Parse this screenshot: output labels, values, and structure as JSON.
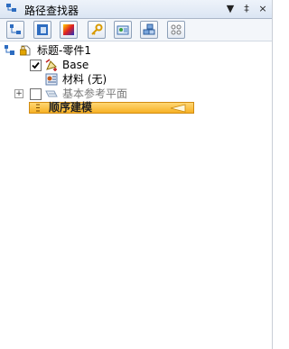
{
  "window": {
    "title": "路径查找器",
    "controls": {
      "dropdown": "▼",
      "pin": "‡",
      "close": "×"
    }
  },
  "toolbar": {
    "buttons": [
      {
        "icon": "tree-hierarchy-icon"
      },
      {
        "icon": "layout-view-icon"
      },
      {
        "icon": "color-view-icon"
      },
      {
        "icon": "key-icon"
      },
      {
        "icon": "image-view-icon"
      },
      {
        "icon": "assembly-icon"
      },
      {
        "icon": "grid-view-icon"
      }
    ]
  },
  "tree": {
    "root": {
      "label": "标题-零件1"
    },
    "items": [
      {
        "label": "Base",
        "checked": true
      },
      {
        "label": "材料 (无)"
      },
      {
        "label": "基本参考平面",
        "checked": false,
        "expandable": true,
        "dimmed": true
      }
    ],
    "rollbar": {
      "label": "顺序建模"
    }
  },
  "colors": {
    "rollbar": "#f7b125",
    "dimmed_text": "#7a7a7a"
  }
}
